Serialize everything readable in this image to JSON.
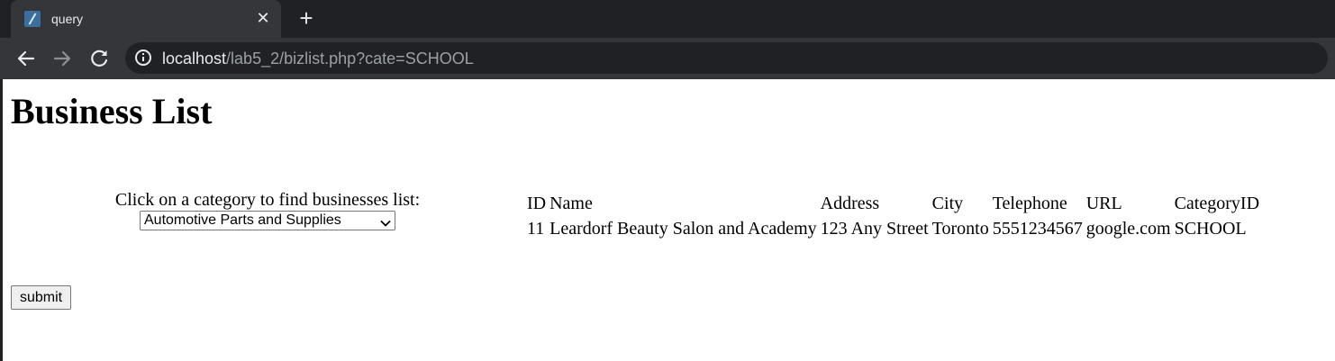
{
  "browser": {
    "tab_title": "query",
    "tab_close_glyph": "✕",
    "new_tab_glyph": "+",
    "url_host": "localhost",
    "url_path": "/lab5_2/bizlist.php?cate=SCHOOL",
    "icons": [
      "back-arrow-icon",
      "forward-arrow-icon",
      "reload-icon",
      "info-icon",
      "favicon-icon"
    ]
  },
  "page": {
    "heading": "Business List",
    "category_prompt": "Click on a category to find businesses list:",
    "category_selected": "Automotive Parts and Supplies",
    "submit_label": "submit"
  },
  "table": {
    "headers": [
      "ID",
      "Name",
      "Address",
      "City",
      "Telephone",
      "URL",
      "CategoryID"
    ],
    "rows": [
      [
        "11",
        "Leardorf Beauty Salon and Academy",
        "123 Any Street",
        "Toronto",
        "5551234567",
        "google.com",
        "SCHOOL"
      ]
    ]
  },
  "colors": {
    "tabstrip_bg": "#202124",
    "toolbar_bg": "#35363a",
    "omnibox_bg": "#202124",
    "page_bg": "#ffffff"
  }
}
